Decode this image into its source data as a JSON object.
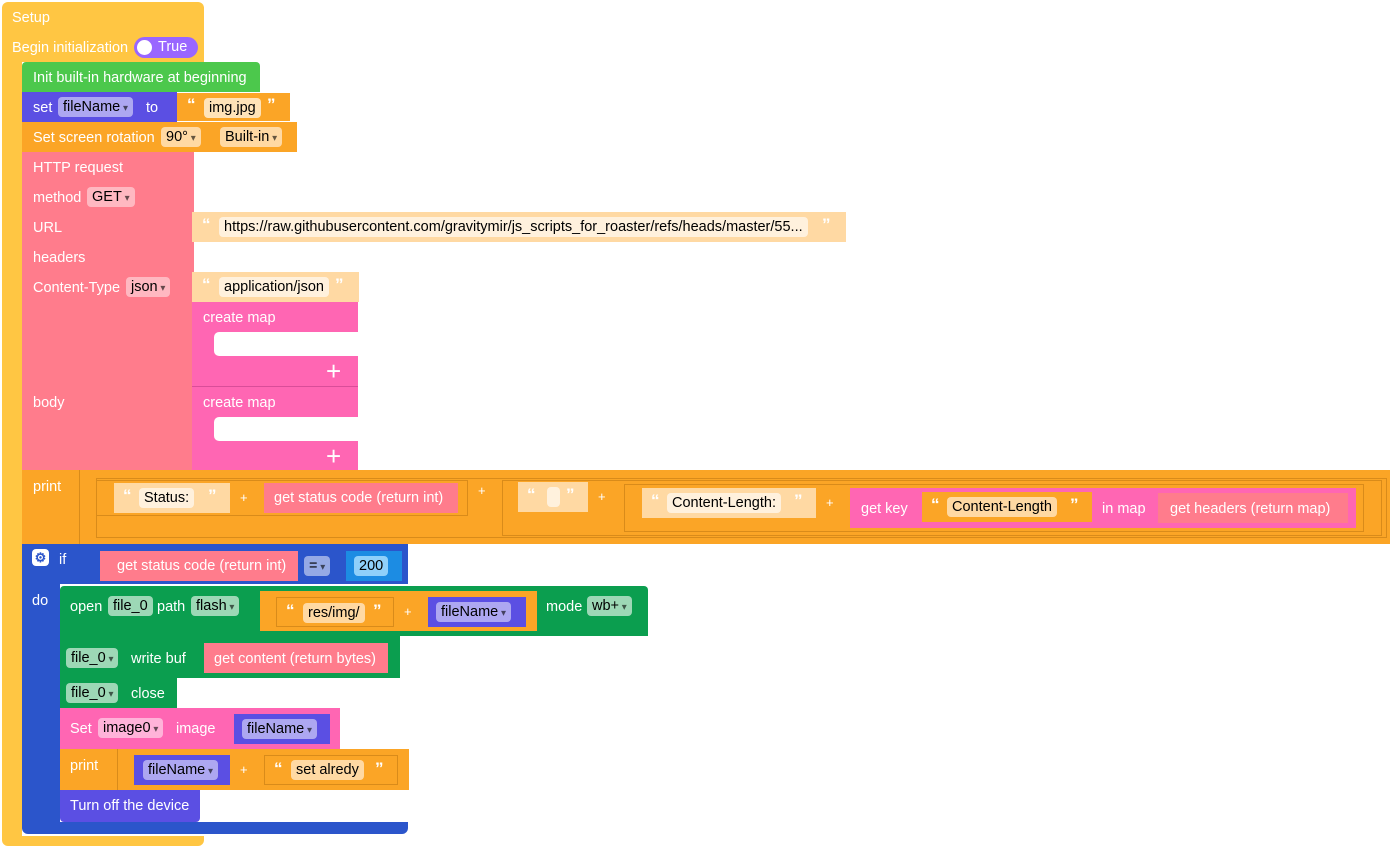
{
  "setup": {
    "title": "Setup",
    "begin_label": "Begin initialization",
    "toggle_value": "True"
  },
  "init_hw": {
    "label": "Init built-in hardware at beginning"
  },
  "set_var": {
    "set_label": "set",
    "var": "fileName",
    "to_label": "to",
    "value": "img.jpg"
  },
  "rotation": {
    "label": "Set screen rotation",
    "angle": "90°",
    "screen": "Built-in"
  },
  "http": {
    "title": "HTTP request",
    "method_label": "method",
    "method": "GET",
    "url_label": "URL",
    "url": "https://raw.githubusercontent.com/gravitymir/js_scripts_for_roaster/refs/heads/master/55...",
    "headers_label": "headers",
    "content_type_label": "Content-Type",
    "content_type": "json",
    "content_type_value": "application/json",
    "create_map": "create map",
    "body_label": "body"
  },
  "print1": {
    "label": "print",
    "status_text": "Status:",
    "status_code": "get status code (return int)",
    "empty_text": "",
    "content_length_text": "Content-Length:",
    "get_key": "get key",
    "key": "Content-Length",
    "in_map": "in map",
    "get_headers": "get headers (return map)",
    "plus": "+"
  },
  "if_block": {
    "if_label": "if",
    "do_label": "do",
    "condition": "get status code (return int)",
    "op": "=",
    "value": "200"
  },
  "open_file": {
    "open_label": "open",
    "file": "file_0",
    "path_label": "path",
    "storage": "flash",
    "prefix": "res/img/",
    "var": "fileName",
    "mode_label": "mode",
    "mode": "wb+"
  },
  "write_buf": {
    "file": "file_0",
    "label": "write buf",
    "content": "get content (return bytes)"
  },
  "close_file": {
    "file": "file_0",
    "label": "close"
  },
  "set_image": {
    "set_label": "Set",
    "image": "image0",
    "image_label": "image",
    "var": "fileName"
  },
  "print2": {
    "label": "print",
    "var": "fileName",
    "text": "set alredy"
  },
  "turn_off": {
    "label": "Turn off the device"
  }
}
